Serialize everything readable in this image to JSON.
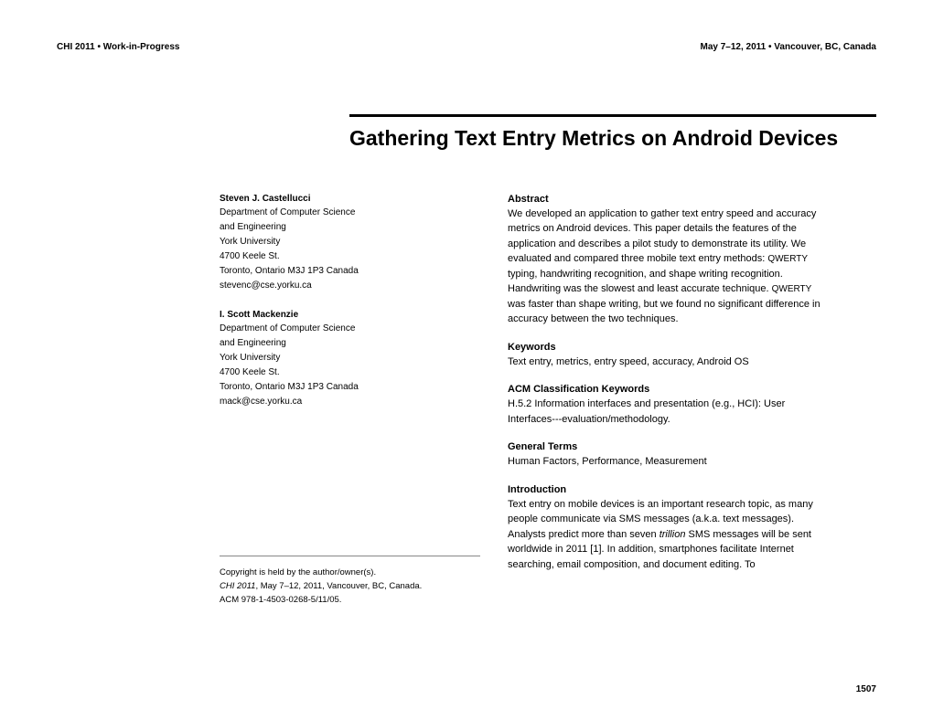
{
  "header": {
    "left": "CHI 2011 • Work-in-Progress",
    "right": "May 7–12, 2011 • Vancouver, BC, Canada"
  },
  "title": "Gathering Text Entry Metrics on Android Devices",
  "authors": [
    {
      "name": "Steven J. Castellucci",
      "lines": [
        "Department of Computer Science",
        "and Engineering",
        "York University",
        "4700 Keele St.",
        "Toronto, Ontario M3J 1P3 Canada",
        "stevenc@cse.yorku.ca"
      ]
    },
    {
      "name": "I. Scott Mackenzie",
      "lines": [
        "Department of Computer Science",
        "and Engineering",
        "York University",
        "4700 Keele St.",
        "Toronto, Ontario M3J 1P3 Canada",
        "mack@cse.yorku.ca"
      ]
    }
  ],
  "copyright": {
    "line1": "Copyright is held by the author/owner(s).",
    "line2_prefix": "CHI 2011",
    "line2_suffix": ", May 7–12, 2011, Vancouver, BC, Canada.",
    "line3": "ACM  978-1-4503-0268-5/11/05."
  },
  "sections": {
    "abstract": {
      "heading": "Abstract",
      "text": "We developed an application to gather text entry speed and accuracy metrics on Android devices. This paper details the features of the application and describes a pilot study to demonstrate its utility. We evaluated and compared three mobile text entry methods: QWERTY typing, handwriting recognition, and shape writing recognition. Handwriting was the slowest and least accurate technique. QWERTY was faster than shape writing, but we found no significant difference in accuracy between the two techniques."
    },
    "keywords": {
      "heading": "Keywords",
      "text": "Text entry, metrics, entry speed, accuracy, Android OS"
    },
    "acm": {
      "heading": "ACM Classification Keywords",
      "text": "H.5.2 Information interfaces and presentation (e.g., HCI): User Interfaces---evaluation/methodology."
    },
    "terms": {
      "heading": "General Terms",
      "text": "Human Factors, Performance, Measurement"
    },
    "intro": {
      "heading": "Introduction",
      "text": "Text entry on mobile devices is an important research topic, as many people communicate via SMS messages (a.k.a. text messages). Analysts predict more than seven trillion SMS messages will be sent worldwide in 2011 [1]. In addition, smartphones facilitate Internet searching, email composition, and document editing. To"
    }
  },
  "page_number": "1507"
}
